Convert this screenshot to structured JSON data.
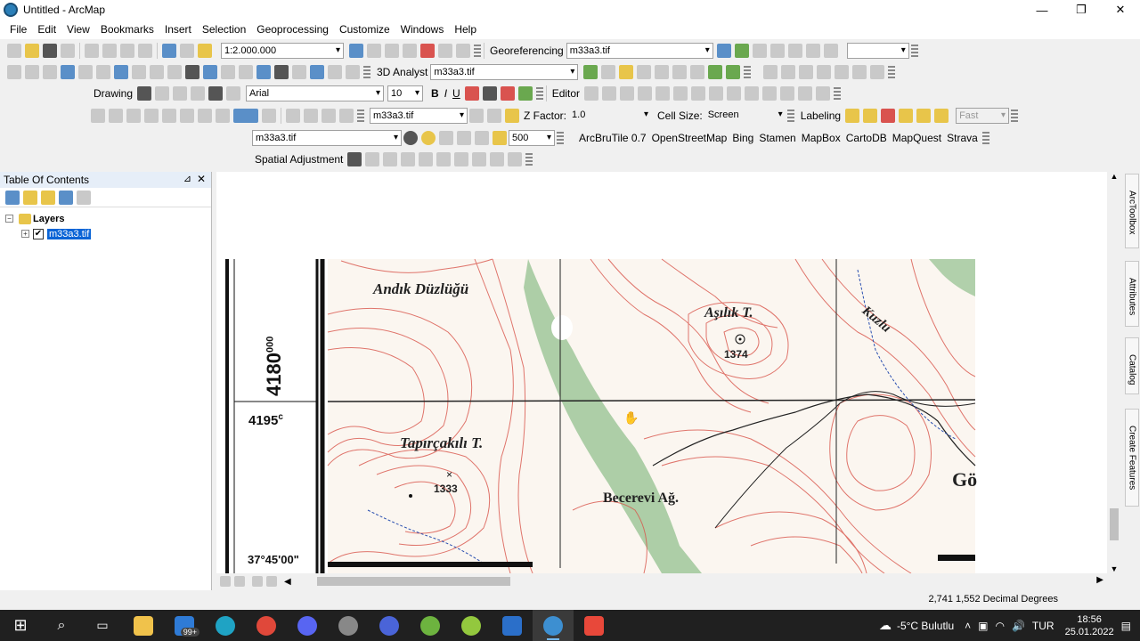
{
  "window": {
    "title": "Untitled - ArcMap",
    "controls": {
      "minimize": "—",
      "maximize": "❐",
      "close": "✕"
    }
  },
  "menu": [
    "File",
    "Edit",
    "View",
    "Bookmarks",
    "Insert",
    "Selection",
    "Geoprocessing",
    "Customize",
    "Windows",
    "Help"
  ],
  "toolbars": {
    "scale": "1:2.000.000",
    "georeferencing_label": "Georeferencing",
    "georef_layer": "m33a3.tif",
    "analyst_label": "3D Analyst",
    "analyst_layer": "m33a3.tif",
    "drawing_label": "Drawing",
    "font_name": "Arial",
    "font_size": "10",
    "bold": "B",
    "italic": "I",
    "underline": "U",
    "editor_label": "Editor",
    "surface_layer": "m33a3.tif",
    "zfactor_label": "Z Factor:",
    "zfactor_value": "1.0",
    "cellsize_label": "Cell Size:",
    "cellsize_value": "Screen",
    "labeling_label": "Labeling",
    "labeling_quality": "Fast",
    "effects_layer": "m33a3.tif",
    "swipe_value": "500",
    "arcbrutile_label": "ArcBruTile 0.7",
    "tile_providers": [
      "OpenStreetMap",
      "Bing",
      "Stamen",
      "MapBox",
      "CartoDB",
      "MapQuest",
      "Strava"
    ],
    "spatial_adjustment_label": "Spatial Adjustment"
  },
  "toc": {
    "title": "Table Of Contents",
    "pin": "⊿",
    "close": "✕",
    "group": "Layers",
    "layer": "m33a3.tif",
    "layer_checked": "✔",
    "expand_symbol": "−",
    "collapse_symbol": "+"
  },
  "map": {
    "labels": {
      "andik": "Andık Düzlüğü",
      "asilik": "Aşılık T.",
      "asilik_elev": "1374",
      "kuzlu": "Kuzlu",
      "tapircakili": "Tapırçakılı T.",
      "tapir_elev": "1333",
      "becerevi": "Becerevi Ağ.",
      "go": "Gö",
      "left_north": "4180",
      "left_north_sup": "000",
      "left_coord": "4195",
      "left_coord_sup": "c",
      "left_lat": "37°45'00\""
    }
  },
  "dock_tabs": [
    "ArcToolbox",
    "Attributes",
    "Catalog",
    "Create Features"
  ],
  "status": {
    "coordinates": "2,741  1,552 Decimal Degrees"
  },
  "taskbar": {
    "mail_badge": "99+",
    "weather": "-5°C  Bulutlu",
    "language": "TUR",
    "time": "18:56",
    "date": "25.01.2022"
  }
}
